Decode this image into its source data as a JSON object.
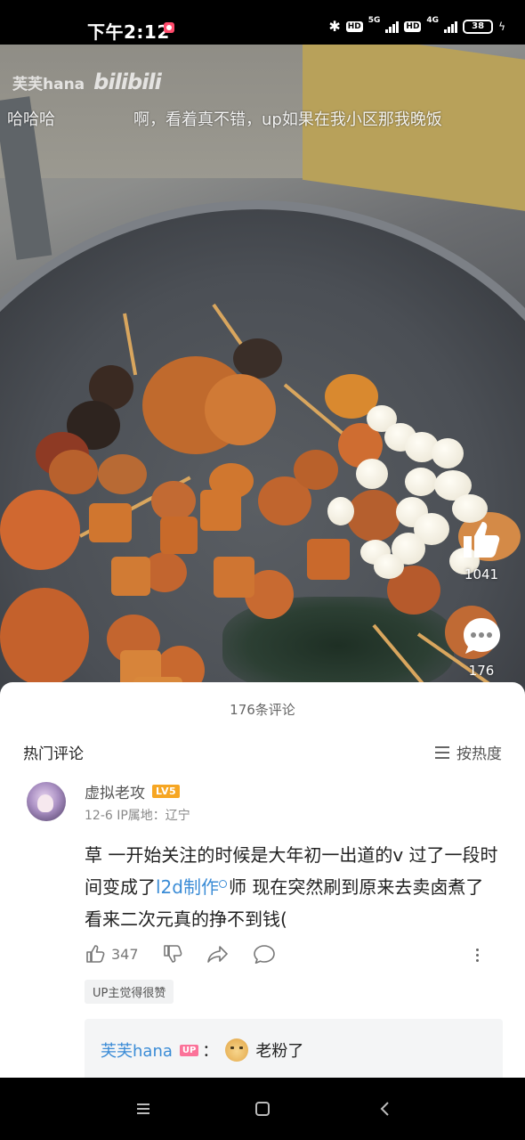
{
  "status_bar": {
    "time": "下午2:12",
    "hd1": "HD",
    "net1": "5G",
    "hd2": "HD",
    "net2": "4G",
    "battery": "38"
  },
  "video": {
    "watermark_user": "芙芙hana",
    "watermark_logo": "bilibili",
    "danmaku": [
      "哈哈哈",
      "啊，看着真不错，up如果在我小区那我晚饭"
    ],
    "like_count": "1041",
    "comment_count": "176"
  },
  "comments": {
    "title": "176条评论",
    "section_label": "热门评论",
    "sort_label": "按热度",
    "items": [
      {
        "username": "虚拟老攻",
        "level": "LV5",
        "meta": "12-6  IP属地：辽宁",
        "text_before_link": "草 一开始关注的时候是大年初一出道的v 过了一段时间变成了",
        "link_text": "l2d制作",
        "text_after_link": "师 现在突然刷到原来去卖卤煮了 看来二次元真的挣不到钱(",
        "like_count": "347",
        "up_tag": "UP主觉得很赞",
        "reply": {
          "author": "芙芙hana",
          "badge": "UP",
          "separator": "：",
          "text": "老粉了"
        }
      }
    ]
  },
  "colors": {
    "link": "#3b8cd6",
    "up_badge": "#fb7299",
    "level_badge": "#f6a623"
  }
}
